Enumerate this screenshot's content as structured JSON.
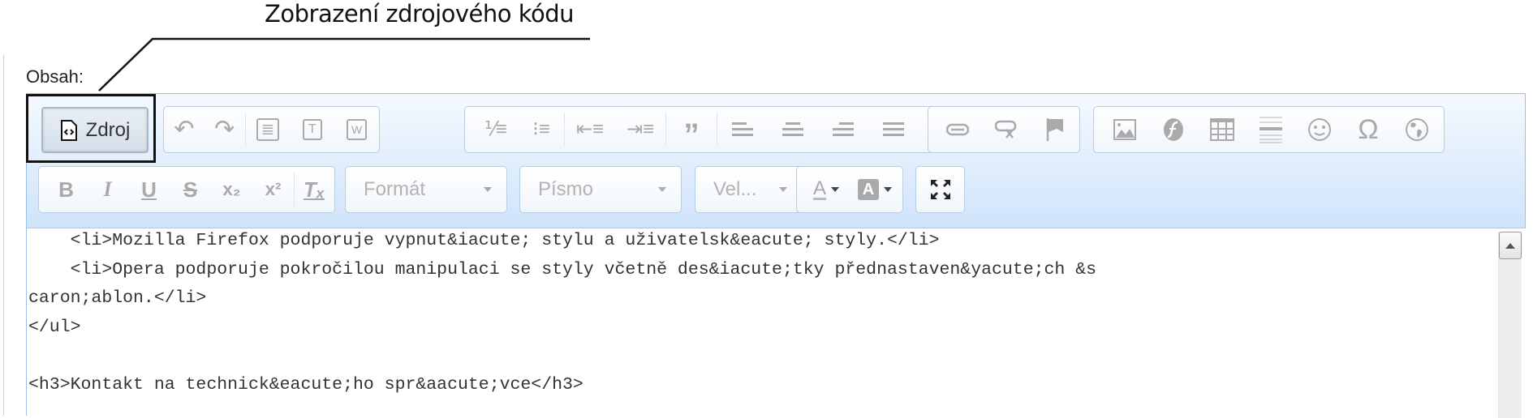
{
  "annotation": {
    "callout_text": "Zobrazení zdrojového kódu"
  },
  "field": {
    "label": "Obsah:"
  },
  "toolbar": {
    "row1": {
      "source_button": {
        "label": "Zdroj",
        "icon": "source-code-icon"
      },
      "history_group": [
        {
          "name": "undo",
          "icon": "undo-icon",
          "glyph": "↶"
        },
        {
          "name": "redo",
          "icon": "redo-icon",
          "glyph": "↷"
        }
      ],
      "clipboard_group": [
        {
          "name": "paste",
          "icon": "paste-icon",
          "glyph": "≣"
        },
        {
          "name": "paste-text",
          "icon": "paste-text-icon",
          "glyph": "T"
        },
        {
          "name": "paste-word",
          "icon": "paste-word-icon",
          "glyph": "W"
        }
      ],
      "paragraph_group": [
        {
          "name": "numbered-list",
          "icon": "numbered-list-icon",
          "glyph": "⒈"
        },
        {
          "name": "bulleted-list",
          "icon": "bulleted-list-icon",
          "glyph": "•"
        },
        {
          "name": "outdent",
          "icon": "outdent-icon",
          "glyph": "⇤"
        },
        {
          "name": "indent",
          "icon": "indent-icon",
          "glyph": "⇥"
        },
        {
          "name": "blockquote",
          "icon": "blockquote-icon",
          "glyph": "❞"
        },
        {
          "name": "align-left",
          "icon": "align-left-icon",
          "glyph": "☰"
        },
        {
          "name": "align-center",
          "icon": "align-center-icon",
          "glyph": "☰"
        },
        {
          "name": "align-right",
          "icon": "align-right-icon",
          "glyph": "☰"
        },
        {
          "name": "align-justify",
          "icon": "align-justify-icon",
          "glyph": "☰"
        }
      ],
      "links_group": [
        {
          "name": "link",
          "icon": "link-icon",
          "glyph": "⊖"
        },
        {
          "name": "unlink",
          "icon": "unlink-icon",
          "glyph": "⊗"
        },
        {
          "name": "anchor",
          "icon": "anchor-flag-icon",
          "glyph": "⚑"
        }
      ],
      "insert_group": [
        {
          "name": "image",
          "icon": "image-icon",
          "glyph": "▨"
        },
        {
          "name": "flash",
          "icon": "flash-icon",
          "glyph": "ƒ"
        },
        {
          "name": "table",
          "icon": "table-icon",
          "glyph": "▦"
        },
        {
          "name": "horizontal-rule",
          "icon": "horizontal-rule-icon",
          "glyph": "≡"
        },
        {
          "name": "smiley",
          "icon": "smiley-icon",
          "glyph": "☺"
        },
        {
          "name": "special-char",
          "icon": "omega-icon",
          "glyph": "Ω"
        },
        {
          "name": "iframe",
          "icon": "globe-icon",
          "glyph": "◍"
        }
      ]
    },
    "row2": {
      "basic_styles": [
        {
          "name": "bold",
          "icon": "bold-icon",
          "glyph": "B"
        },
        {
          "name": "italic",
          "icon": "italic-icon",
          "glyph": "I"
        },
        {
          "name": "underline",
          "icon": "underline-icon",
          "glyph": "U"
        },
        {
          "name": "strike",
          "icon": "strikethrough-icon",
          "glyph": "S"
        },
        {
          "name": "subscript",
          "icon": "subscript-icon",
          "glyph": "x₂"
        },
        {
          "name": "superscript",
          "icon": "superscript-icon",
          "glyph": "x²"
        },
        {
          "name": "remove-format",
          "icon": "remove-format-icon",
          "glyph": "Tₓ"
        }
      ],
      "format_combo": "Formát",
      "font_combo": "Písmo",
      "size_combo": "Vel...",
      "colors": [
        {
          "name": "text-color",
          "icon": "text-color-icon",
          "glyph": "A"
        },
        {
          "name": "bg-color",
          "icon": "background-color-icon",
          "glyph": "A"
        }
      ],
      "maximize": {
        "name": "maximize",
        "icon": "maximize-icon"
      }
    }
  },
  "source": {
    "lines": [
      "    <li>Mozilla Firefox podporuje vypnut&iacute; stylu a uživatelsk&eacute; styly.</li>",
      "    <li>Opera podporuje pokročilou manipulaci se styly včetně des&iacute;tky přednastaven&yacute;ch &s",
      "caron;ablon.</li>",
      "</ul>",
      "",
      "<h3>Kontakt na technick&eacute;ho spr&aacute;vce</h3>"
    ]
  }
}
